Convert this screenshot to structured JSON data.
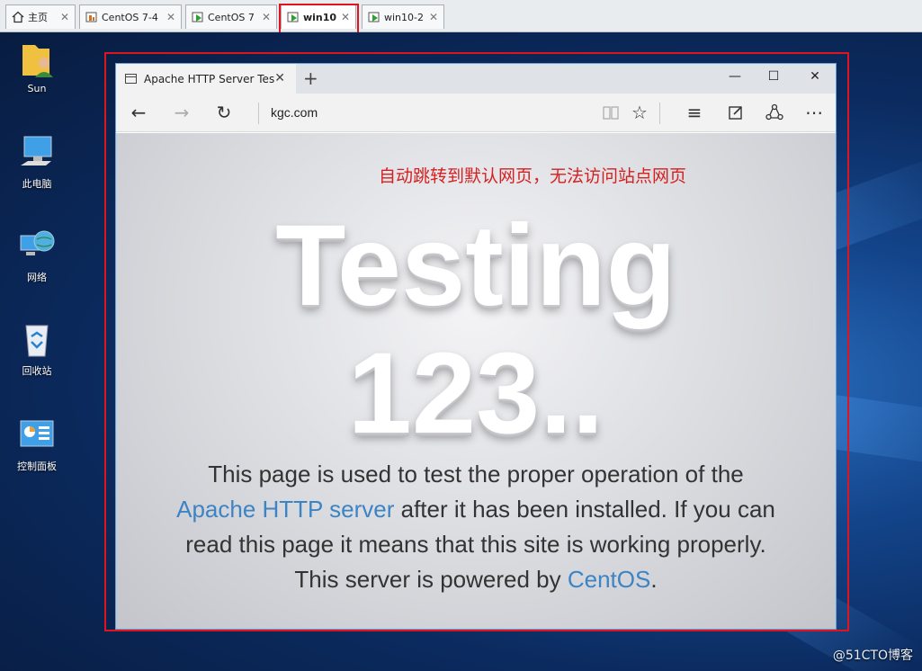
{
  "vm_tabs": [
    {
      "label": "主页",
      "icon": "home-icon"
    },
    {
      "label": "CentOS 7-4",
      "icon": "vm-icon"
    },
    {
      "label": "CentOS 7",
      "icon": "vm-running-icon"
    },
    {
      "label": "win10",
      "icon": "vm-running-icon",
      "active": true
    },
    {
      "label": "win10-2",
      "icon": "vm-running-icon"
    }
  ],
  "desktop_icons": [
    {
      "label": "Sun",
      "icon": "user-folder-icon"
    },
    {
      "label": "此电脑",
      "icon": "computer-icon"
    },
    {
      "label": "网络",
      "icon": "network-icon"
    },
    {
      "label": "回收站",
      "icon": "recycle-bin-icon"
    },
    {
      "label": "控制面板",
      "icon": "control-panel-icon"
    }
  ],
  "browser": {
    "tab_title": "Apache HTTP Server Tes",
    "address": "kgc.com",
    "window_controls": {
      "minimize": "—",
      "maximize": "☐",
      "close": "✕"
    }
  },
  "page": {
    "annotation": "自动跳转到默认网页，无法访问站点网页",
    "headline_line1": "Testing",
    "headline_line2": "123..",
    "desc_part1": "This page is used to test the proper operation of the ",
    "desc_link1": "Apache HTTP server",
    "desc_part2": " after it has been installed. If you can read this page it means that this site is working properly. This server is powered by ",
    "desc_link2": "CentOS",
    "desc_part3": "."
  },
  "watermark": "@51CTO博客",
  "colors": {
    "accent_red": "#e0141e",
    "link": "#3c84c4",
    "annotation": "#d42020"
  }
}
